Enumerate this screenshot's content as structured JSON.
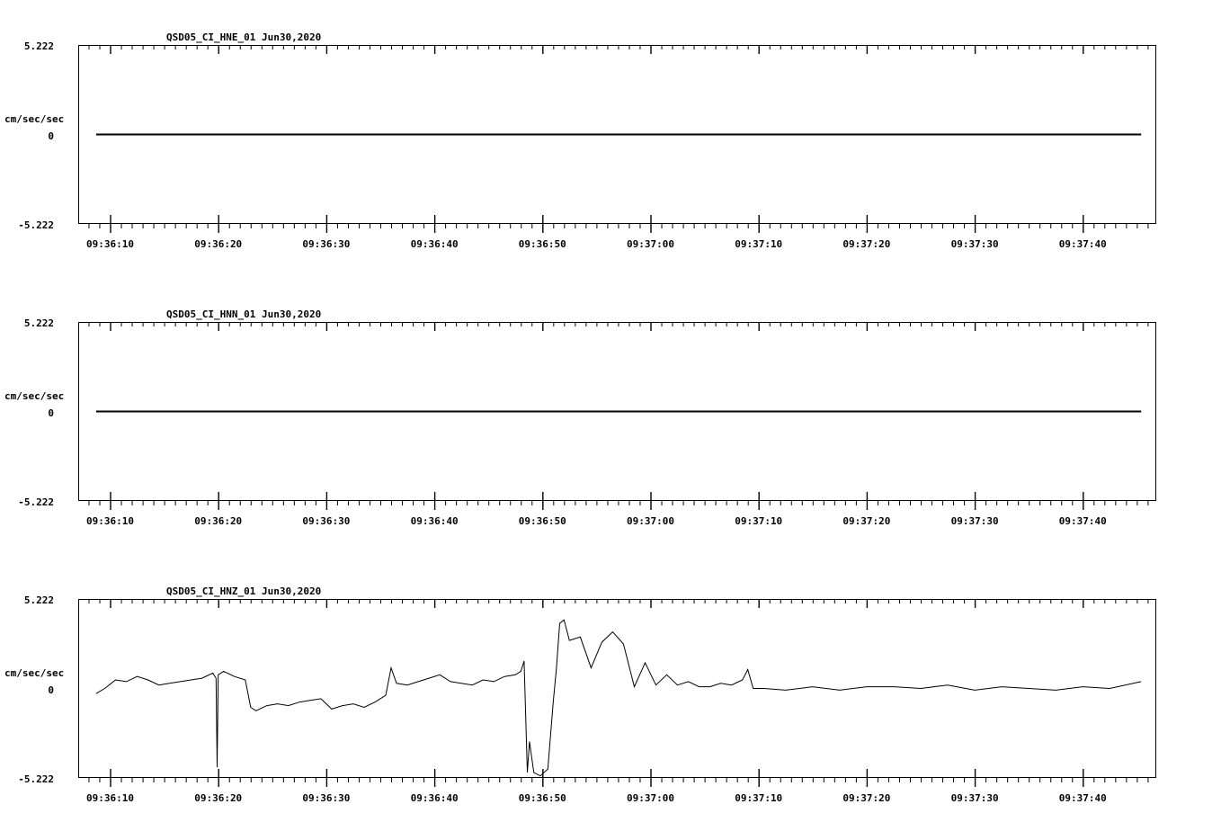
{
  "chart_data": [
    {
      "type": "line",
      "title": "QSD05_CI_HNE_01  Jun30,2020",
      "ylabel": "cm/sec/sec",
      "ylim": [
        -5.222,
        5.222
      ],
      "yticks": [
        "5.222",
        "0",
        "-5.222"
      ],
      "xlim": [
        "09:36:07",
        "09:37:47"
      ],
      "xticks": [
        "09:36:10",
        "09:36:20",
        "09:36:30",
        "09:36:40",
        "09:36:50",
        "09:37:00",
        "09:37:10",
        "09:37:20",
        "09:37:30",
        "09:37:40"
      ],
      "series": [
        {
          "x": [
            "09:36:08.7",
            "09:37:45.4"
          ],
          "y": [
            0,
            0
          ]
        }
      ]
    },
    {
      "type": "line",
      "title": "QSD05_CI_HNN_01  Jun30,2020",
      "ylabel": "cm/sec/sec",
      "ylim": [
        -5.222,
        5.222
      ],
      "yticks": [
        "5.222",
        "0",
        "-5.222"
      ],
      "xlim": [
        "09:36:07",
        "09:37:47"
      ],
      "xticks": [
        "09:36:10",
        "09:36:20",
        "09:36:30",
        "09:36:40",
        "09:36:50",
        "09:37:00",
        "09:37:10",
        "09:37:20",
        "09:37:30",
        "09:37:40"
      ],
      "series": [
        {
          "x": [
            "09:36:08.7",
            "09:37:45.4"
          ],
          "y": [
            0,
            0
          ]
        }
      ]
    },
    {
      "type": "line",
      "title": "QSD05_CI_HNZ_01  Jun30,2020",
      "ylabel": "cm/sec/sec",
      "ylim": [
        -5.222,
        5.222
      ],
      "yticks": [
        "5.222",
        "0",
        "-5.222"
      ],
      "xlim": [
        "09:36:07",
        "09:37:47"
      ],
      "xticks": [
        "09:36:10",
        "09:36:20",
        "09:36:30",
        "09:36:40",
        "09:36:50",
        "09:37:00",
        "09:37:10",
        "09:37:20",
        "09:37:30",
        "09:37:40"
      ],
      "series": [
        {
          "x": [
            "09:36:08.7",
            "09:36:09.5",
            "09:36:10.5",
            "09:36:11.5",
            "09:36:12.5",
            "09:36:13.5",
            "09:36:14.5",
            "09:36:15.5",
            "09:36:16.5",
            "09:36:17.5",
            "09:36:18.5",
            "09:36:19.5",
            "09:36:19.8",
            "09:36:19.9",
            "09:36:20.0",
            "09:36:20.5",
            "09:36:21.5",
            "09:36:22.5",
            "09:36:23.0",
            "09:36:23.5",
            "09:36:24.5",
            "09:36:25.5",
            "09:36:26.5",
            "09:36:27.5",
            "09:36:28.5",
            "09:36:29.5",
            "09:36:30.5",
            "09:36:31.5",
            "09:36:32.5",
            "09:36:33.5",
            "09:36:34.5",
            "09:36:35.5",
            "09:36:36.0",
            "09:36:36.5",
            "09:36:37.5",
            "09:36:38.5",
            "09:36:39.5",
            "09:36:40.5",
            "09:36:41.5",
            "09:36:42.5",
            "09:36:43.5",
            "09:36:44.5",
            "09:36:45.5",
            "09:36:46.5",
            "09:36:47.5",
            "09:36:48.0",
            "09:36:48.3",
            "09:36:48.6",
            "09:36:48.8",
            "09:36:49.2",
            "09:36:49.8",
            "09:36:50.5",
            "09:36:51.0",
            "09:36:51.3",
            "09:36:51.6",
            "09:36:52.0",
            "09:36:52.5",
            "09:36:53.5",
            "09:36:54.5",
            "09:36:55.5",
            "09:36:56.5",
            "09:36:57.5",
            "09:36:58.5",
            "09:36:59.5",
            "09:37:00.5",
            "09:37:01.5",
            "09:37:02.5",
            "09:37:03.5",
            "09:37:04.5",
            "09:37:05.5",
            "09:37:06.5",
            "09:37:07.5",
            "09:37:08.5",
            "09:37:09.0",
            "09:37:09.5",
            "09:37:10.5",
            "09:37:12.5",
            "09:37:15.0",
            "09:37:17.5",
            "09:37:20.0",
            "09:37:22.5",
            "09:37:25.0",
            "09:37:27.5",
            "09:37:30.0",
            "09:37:32.5",
            "09:37:35.0",
            "09:37:37.5",
            "09:37:40.0",
            "09:37:42.5",
            "09:37:45.4"
          ],
          "y": [
            -0.3,
            0.0,
            0.5,
            0.4,
            0.7,
            0.5,
            0.2,
            0.3,
            0.4,
            0.5,
            0.6,
            0.9,
            0.6,
            -4.6,
            0.8,
            1.0,
            0.7,
            0.5,
            -1.1,
            -1.3,
            -1.0,
            -0.9,
            -1.0,
            -0.8,
            -0.7,
            -0.6,
            -1.2,
            -1.0,
            -0.9,
            -1.1,
            -0.8,
            -0.4,
            1.2,
            0.3,
            0.2,
            0.4,
            0.6,
            0.8,
            0.4,
            0.3,
            0.2,
            0.5,
            0.4,
            0.7,
            0.8,
            1.0,
            1.6,
            -4.9,
            -3.1,
            -4.9,
            -5.1,
            -4.7,
            -0.8,
            1.2,
            3.8,
            4.0,
            2.8,
            3.0,
            1.2,
            2.7,
            3.3,
            2.6,
            0.1,
            1.5,
            0.2,
            0.8,
            0.2,
            0.4,
            0.1,
            0.1,
            0.3,
            0.2,
            0.5,
            1.1,
            0.0,
            0.0,
            -0.1,
            0.1,
            -0.1,
            0.1,
            0.1,
            0.0,
            0.2,
            -0.1,
            0.1,
            0.0,
            -0.1,
            0.1,
            0.0,
            0.4
          ]
        }
      ]
    }
  ]
}
